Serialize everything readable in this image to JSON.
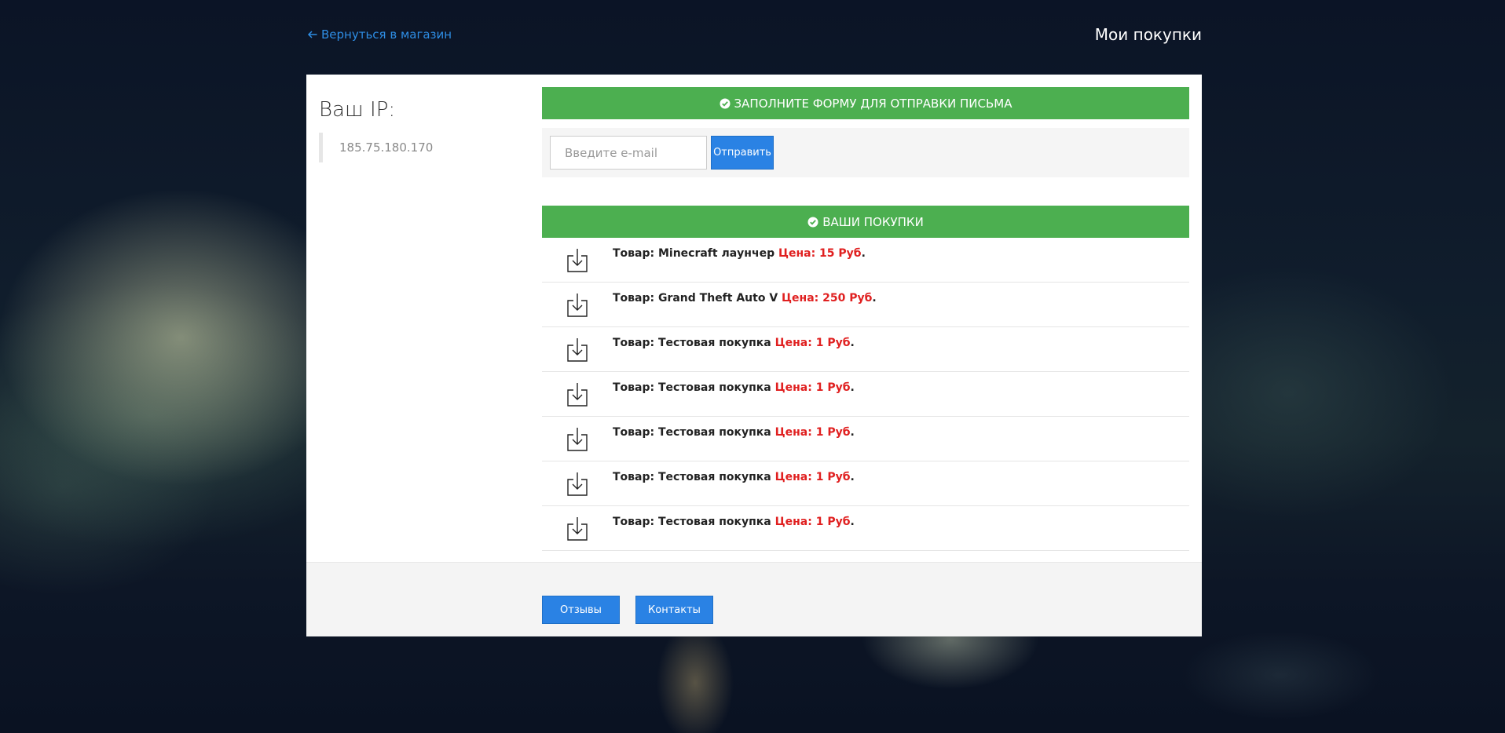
{
  "header": {
    "back_link": "Вернуться в магазин",
    "title": "Мои покупки"
  },
  "sidebar": {
    "ip_title": "Ваш IP:",
    "ip_value": "185.75.180.170"
  },
  "email_form": {
    "heading": "ЗАПОЛНИТЕ ФОРМУ ДЛЯ ОТПРАВКИ ПИСЬМА",
    "placeholder": "Введите e-mail",
    "value": "",
    "send_label": "Отправить"
  },
  "purchases": {
    "heading": "ВАШИ ПОКУПКИ",
    "items": [
      {
        "label": "Товар: Minecraft лаунчер",
        "price": "Цена: 15 Руб",
        "end": "."
      },
      {
        "label": "Товар: Grand Theft Auto V",
        "price": "Цена: 250 Руб",
        "end": "."
      },
      {
        "label": "Товар: Тестовая покупка",
        "price": "Цена: 1 Руб",
        "end": "."
      },
      {
        "label": "Товар: Тестовая покупка",
        "price": "Цена: 1 Руб",
        "end": "."
      },
      {
        "label": "Товар: Тестовая покупка",
        "price": "Цена: 1 Руб",
        "end": "."
      },
      {
        "label": "Товар: Тестовая покупка",
        "price": "Цена: 1 Руб",
        "end": "."
      },
      {
        "label": "Товар: Тестовая покупка",
        "price": "Цена: 1 Руб",
        "end": "."
      }
    ]
  },
  "footer": {
    "reviews_label": "Отзывы",
    "contacts_label": "Контакты"
  },
  "colors": {
    "accent_blue": "#2a82e4",
    "header_green": "#4caf50",
    "price_red": "#e02020"
  },
  "icons": {
    "back": "arrow-left-icon",
    "check": "check-circle-icon",
    "download": "download-icon"
  }
}
